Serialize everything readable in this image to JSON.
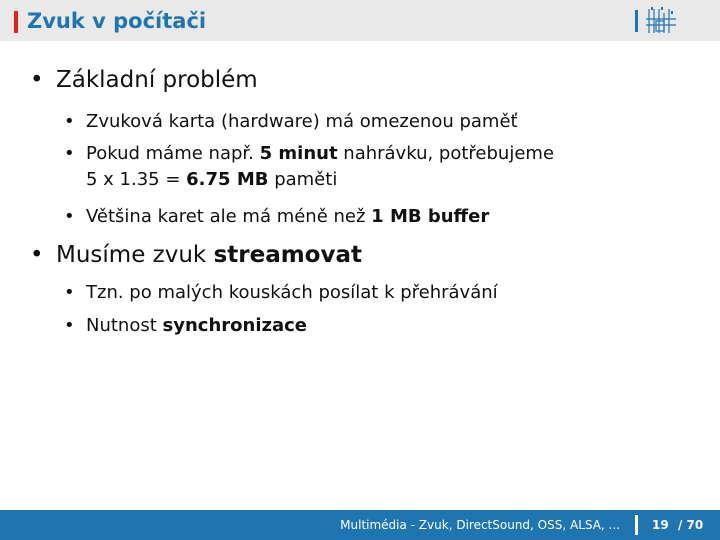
{
  "header": {
    "title": "Zvuk v počítači",
    "accent_color": "#e0201c",
    "brand_color": "#1f75b0",
    "logo": "faculty-logo-icon"
  },
  "bullets": [
    {
      "text": "Základní problém",
      "children": [
        {
          "parts": [
            "Zvuková karta (hardware) má omezenou paměť"
          ]
        },
        {
          "line1": [
            "Pokud máme např. ",
            "5 minut",
            " nahrávku, potřebujeme"
          ],
          "line2": [
            "5 x 1.35 = ",
            "6.75 MB",
            " paměti"
          ]
        },
        {
          "parts": [
            "Většina karet ale má méně než ",
            "1 MB buffer"
          ]
        }
      ]
    },
    {
      "parts": [
        "Musíme zvuk ",
        "streamovat"
      ],
      "children": [
        {
          "parts": [
            "Tzn. po malých kouskách posílat k přehrávání"
          ]
        },
        {
          "parts": [
            "Nutnost ",
            "synchronizace"
          ]
        }
      ]
    }
  ],
  "bullet_symbol": "•",
  "footer": {
    "text": "Multimédia - Zvuk, DirectSound, OSS, ALSA, ...",
    "page": "19",
    "total": "/ 70"
  }
}
